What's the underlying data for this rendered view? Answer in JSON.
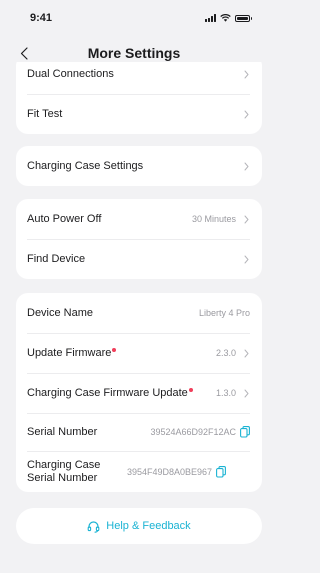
{
  "status": {
    "time": "9:41"
  },
  "header": {
    "title": "More Settings"
  },
  "group1": [
    {
      "label": "Dual Connections"
    },
    {
      "label": "Fit Test"
    }
  ],
  "group2": [
    {
      "label": "Charging Case Settings"
    }
  ],
  "group3": [
    {
      "label": "Auto Power Off",
      "value": "30 Minutes"
    },
    {
      "label": "Find Device"
    }
  ],
  "device_info": [
    {
      "label": "Device Name",
      "value": "Liberty 4 Pro"
    },
    {
      "label": "Update Firmware",
      "value": "2.3.0"
    },
    {
      "label": "Charging Case Firmware Update",
      "value": "1.3.0"
    },
    {
      "label": "Serial Number",
      "value": "39524A66D92F12AC"
    },
    {
      "label": "Charging Case Serial Number",
      "value": "3954F49D8A0BE967"
    }
  ],
  "help": {
    "label": "Help & Feedback"
  },
  "colors": {
    "accent": "#1AB3D3",
    "badge": "#F03E5A",
    "background": "#F2F2F4"
  }
}
